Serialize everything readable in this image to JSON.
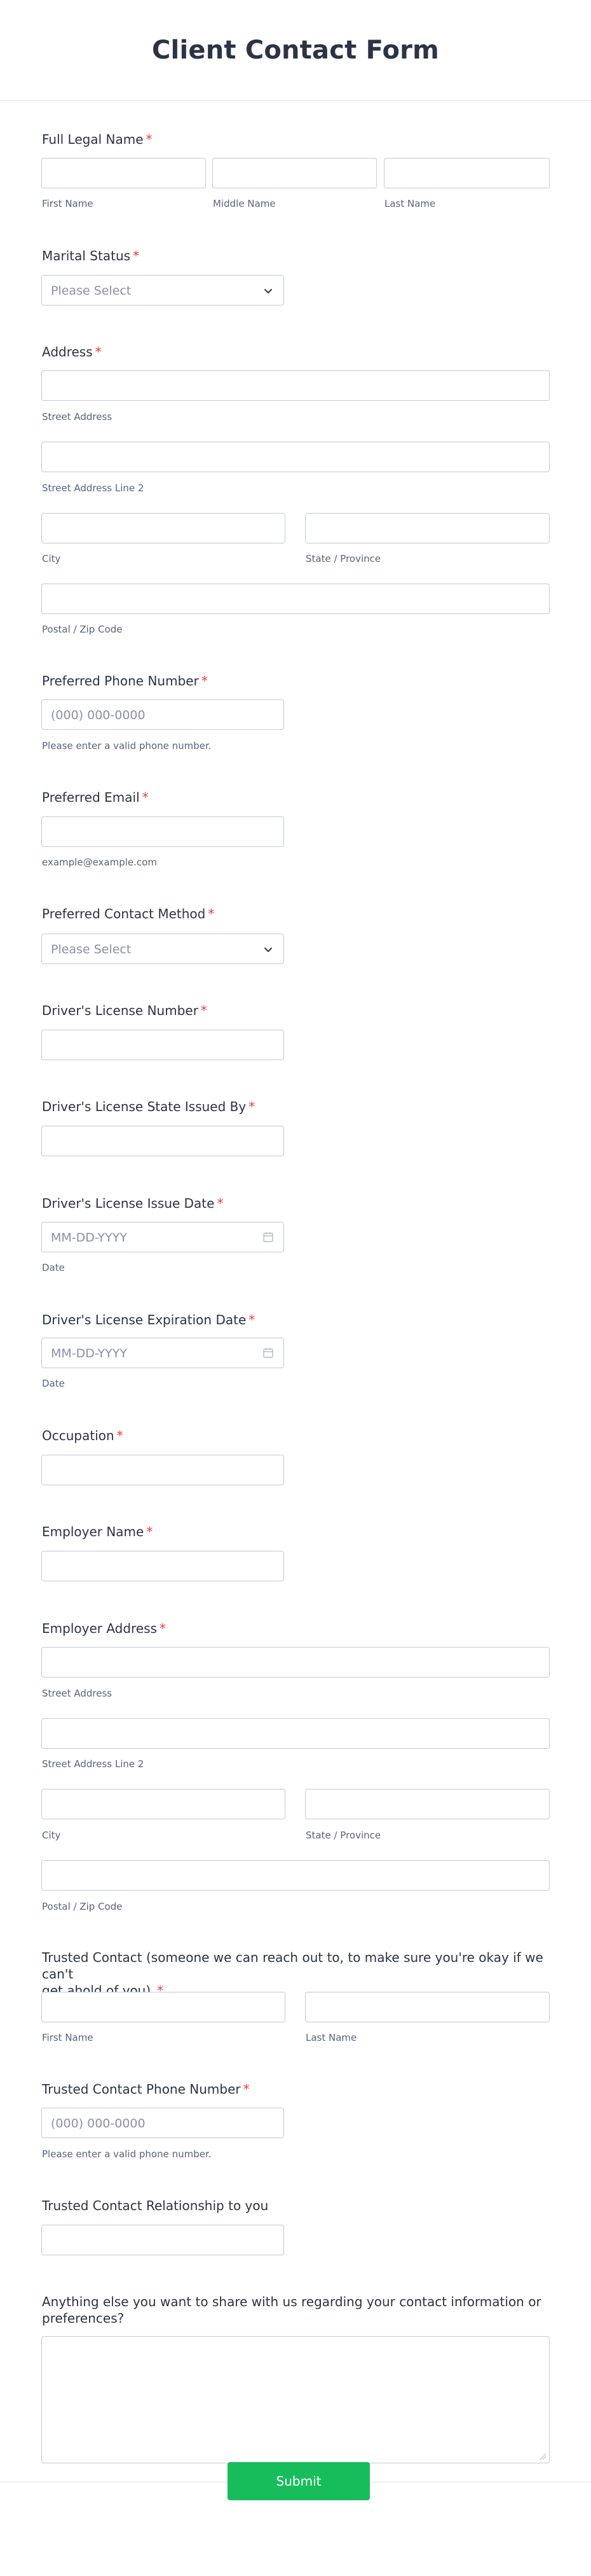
{
  "form": {
    "title": "Client Contact Form",
    "required_mark": "*",
    "submit_label": "Submit"
  },
  "fields": {
    "full_name": {
      "label": "Full Legal Name",
      "first": "First Name",
      "middle": "Middle Name",
      "last": "Last Name"
    },
    "marital": {
      "label": "Marital Status",
      "placeholder": "Please Select"
    },
    "address": {
      "label": "Address",
      "street": "Street Address",
      "street2": "Street Address Line 2",
      "city": "City",
      "state": "State / Province",
      "zip": "Postal / Zip Code"
    },
    "phone": {
      "label": "Preferred Phone Number",
      "placeholder": "(000) 000-0000",
      "hint": "Please enter a valid phone number."
    },
    "email": {
      "label": "Preferred Email",
      "hint": "example@example.com"
    },
    "contact_method": {
      "label": "Preferred Contact Method",
      "placeholder": "Please Select"
    },
    "license_number": {
      "label": "Driver's License Number"
    },
    "license_state": {
      "label": "Driver's License State Issued By"
    },
    "license_issue": {
      "label": "Driver's License Issue Date",
      "placeholder": "MM-DD-YYYY",
      "hint": "Date"
    },
    "license_exp": {
      "label": "Driver's License Expiration Date",
      "placeholder": "MM-DD-YYYY",
      "hint": "Date"
    },
    "occupation": {
      "label": "Occupation"
    },
    "employer_name": {
      "label": "Employer Name"
    },
    "employer_address": {
      "label": "Employer Address",
      "street": "Street Address",
      "street2": "Street Address Line 2",
      "city": "City",
      "state": "State / Province",
      "zip": "Postal / Zip Code"
    },
    "trusted": {
      "label_line1": "Trusted Contact (someone we can reach out to, to make sure you're okay if we can't",
      "label_line2": "get ahold of you)",
      "first": "First Name",
      "last": "Last Name"
    },
    "trusted_phone": {
      "label": "Trusted Contact Phone Number",
      "placeholder": "(000) 000-0000",
      "hint": "Please enter a valid phone number."
    },
    "trusted_relationship": {
      "label": "Trusted Contact Relationship to you"
    },
    "anything_else": {
      "label_line1": "Anything else you want to share with us regarding your contact information or",
      "label_line2": "preferences?"
    }
  },
  "icons": {
    "chevron": "chevron-down-icon",
    "calendar": "calendar-icon"
  },
  "colors": {
    "required": "#f23a3c",
    "submit": "#18bd5b",
    "border": "#c3cad8",
    "text": "#2c3345",
    "sublabel": "#57647e",
    "placeholder": "#8d8fa8"
  }
}
